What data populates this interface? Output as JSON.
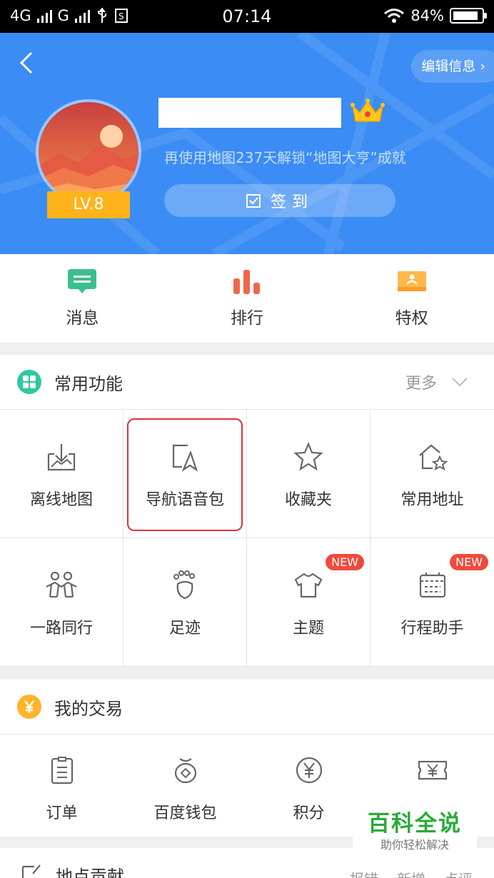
{
  "status_bar": {
    "network_1": "4G",
    "network_2": "G",
    "time": "07:14",
    "battery": "84%"
  },
  "header": {
    "edit_label": "编辑信息",
    "level": "LV.8",
    "unlock_text": "再使用地图237天解锁“地图大亨”成就",
    "checkin_label": "签到"
  },
  "quick_links": [
    {
      "label": "消息",
      "icon": "message-icon"
    },
    {
      "label": "排行",
      "icon": "ranking-icon"
    },
    {
      "label": "特权",
      "icon": "privilege-icon"
    }
  ],
  "common": {
    "title": "常用功能",
    "more": "更多",
    "items": [
      {
        "label": "离线地图",
        "icon": "offline-map-icon"
      },
      {
        "label": "导航语音包",
        "icon": "voice-pack-icon"
      },
      {
        "label": "收藏夹",
        "icon": "star-icon"
      },
      {
        "label": "常用地址",
        "icon": "home-star-icon"
      },
      {
        "label": "一路同行",
        "icon": "people-icon"
      },
      {
        "label": "足迹",
        "icon": "footprint-icon"
      },
      {
        "label": "主题",
        "icon": "shirt-icon",
        "badge": "NEW"
      },
      {
        "label": "行程助手",
        "icon": "calendar-icon",
        "badge": "NEW"
      }
    ]
  },
  "trade": {
    "title": "我的交易",
    "items": [
      {
        "label": "订单",
        "icon": "order-icon"
      },
      {
        "label": "百度钱包",
        "icon": "wallet-icon"
      },
      {
        "label": "积分",
        "icon": "points-icon"
      },
      {
        "label": "",
        "icon": "ticket-icon"
      }
    ]
  },
  "contribution": {
    "title": "地点贡献",
    "actions": [
      "报错",
      "新增",
      "点评"
    ]
  },
  "watermark": {
    "title": "百科全说",
    "subtitle": "助你轻松解决"
  },
  "colors": {
    "header_blue": "#3b8cf5",
    "badge_red": "#f04a3c",
    "level_gold": "#ffb31a",
    "highlight_red": "#e0313b"
  }
}
